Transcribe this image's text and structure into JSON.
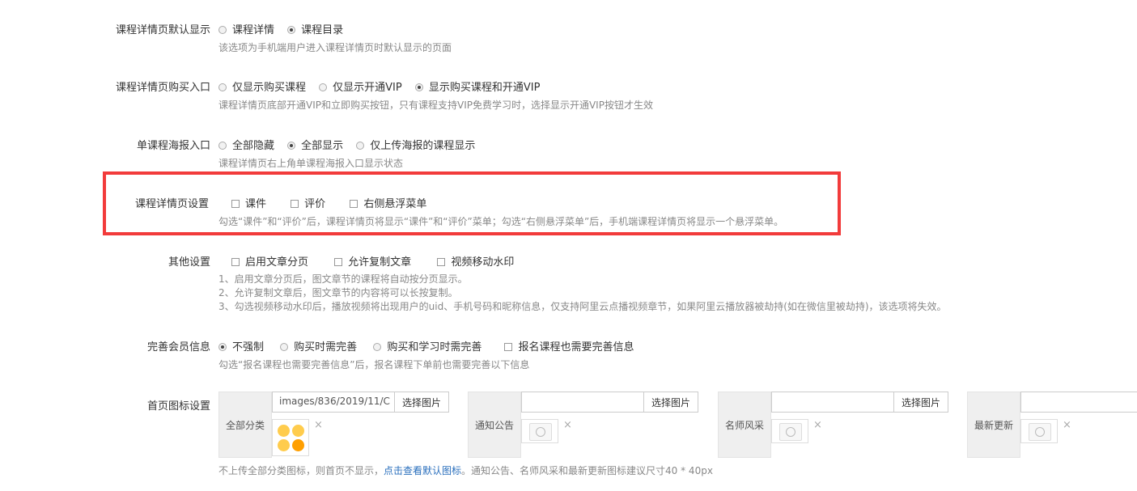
{
  "detail_default": {
    "label": "课程详情页默认显示",
    "options": [
      {
        "text": "课程详情",
        "checked": false
      },
      {
        "text": "课程目录",
        "checked": true
      }
    ],
    "help": "该选项为手机端用户进入课程详情页时默认显示的页面"
  },
  "purchase_entry": {
    "label": "课程详情页购买入口",
    "options": [
      {
        "text": "仅显示购买课程",
        "checked": false
      },
      {
        "text": "仅显示开通VIP",
        "checked": false
      },
      {
        "text": "显示购买课程和开通VIP",
        "checked": true
      }
    ],
    "help": "课程详情页底部开通VIP和立即购买按钮，只有课程支持VIP免费学习时，选择显示开通VIP按钮才生效"
  },
  "poster_entry": {
    "label": "单课程海报入口",
    "options": [
      {
        "text": "全部隐藏",
        "checked": false
      },
      {
        "text": "全部显示",
        "checked": true
      },
      {
        "text": "仅上传海报的课程显示",
        "checked": false
      }
    ],
    "help": "课程详情页右上角单课程海报入口显示状态"
  },
  "detail_settings": {
    "label": "课程详情页设置",
    "options": [
      {
        "text": "课件",
        "checked": false
      },
      {
        "text": "评价",
        "checked": false
      },
      {
        "text": "右侧悬浮菜单",
        "checked": false
      }
    ],
    "help": "勾选“课件”和“评价”后，课程详情页将显示“课件”和“评价”菜单；勾选“右侧悬浮菜单”后，手机端课程详情页将显示一个悬浮菜单。"
  },
  "other_settings": {
    "label": "其他设置",
    "options": [
      {
        "text": "启用文章分页",
        "checked": false
      },
      {
        "text": "允许复制文章",
        "checked": false
      },
      {
        "text": "视频移动水印",
        "checked": false
      }
    ],
    "help_lines": [
      "1、启用文章分页后，图文章节的课程将自动按分页显示。",
      "2、允许复制文章后，图文章节的内容将可以长按复制。",
      "3、勾选视频移动水印后，播放视频将出现用户的uid、手机号码和昵称信息，仅支持阿里云点播视频章节，如果阿里云播放器被劫持(如在微信里被劫持)，该选项将失效。"
    ]
  },
  "member_info": {
    "label": "完善会员信息",
    "radios": [
      {
        "text": "不强制",
        "checked": true
      },
      {
        "text": "购买时需完善",
        "checked": false
      },
      {
        "text": "购买和学习时需完善",
        "checked": false
      }
    ],
    "checkbox": {
      "text": "报名课程也需要完善信息",
      "checked": false
    },
    "help": "勾选“报名课程也需要完善信息”后，报名课程下单前也需要完善以下信息"
  },
  "home_icons": {
    "label": "首页图标设置",
    "groups": [
      {
        "name": "全部分类",
        "path": "images/836/2019/11/C",
        "button": "选择图片",
        "thumb": "dots"
      },
      {
        "name": "通知公告",
        "path": "",
        "button": "选择图片",
        "thumb": "placeholder"
      },
      {
        "name": "名师风采",
        "path": "",
        "button": "选择图片",
        "thumb": "placeholder"
      },
      {
        "name": "最新更新",
        "path": "",
        "button": "选择图片",
        "thumb": "placeholder"
      }
    ],
    "remove_glyph": "×",
    "help_before": "不上传全部分类图标，则首页不显示，",
    "help_link": "点击查看默认图标",
    "help_after": "。通知公告、名师风采和最新更新图标建议尺寸40 * 40px"
  },
  "colors": {
    "highlight": "#f23b3b",
    "link": "#2a6fbd",
    "dot_light": "#ffcc4d",
    "dot_dark": "#ff9f00"
  }
}
